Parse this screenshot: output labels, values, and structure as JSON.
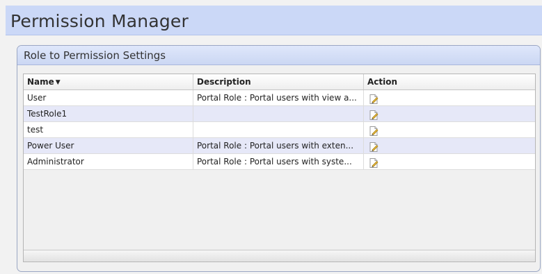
{
  "page": {
    "title": "Permission Manager"
  },
  "panel": {
    "title": "Role to Permission Settings"
  },
  "table": {
    "columns": [
      {
        "label": "Name",
        "sort": "descending"
      },
      {
        "label": "Description"
      },
      {
        "label": "Action"
      }
    ],
    "rows": [
      {
        "name": "User",
        "description": "Portal Role : Portal users with view a...",
        "action_icon": "edit-icon"
      },
      {
        "name": "TestRole1",
        "description": "",
        "action_icon": "edit-icon"
      },
      {
        "name": "test",
        "description": "",
        "action_icon": "edit-icon"
      },
      {
        "name": "Power User",
        "description": "Portal Role : Portal users with exten...",
        "action_icon": "edit-icon"
      },
      {
        "name": "Administrator",
        "description": "Portal Role : Portal users with syste...",
        "action_icon": "edit-icon"
      }
    ]
  },
  "colors": {
    "header_bg": "#cbd8f7",
    "alt_row": "#e6e8f8"
  }
}
